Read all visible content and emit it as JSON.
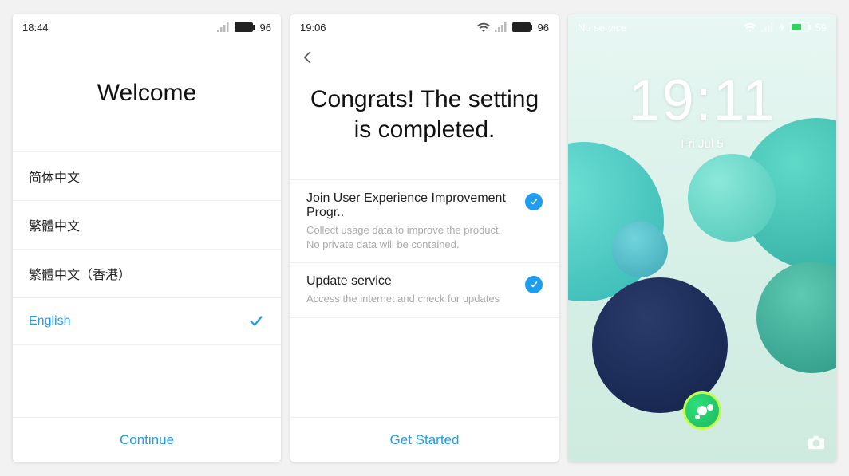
{
  "phone1": {
    "status": {
      "time": "18:44",
      "battery": "96"
    },
    "title": "Welcome",
    "langs": [
      "简体中文",
      "繁體中文",
      "繁體中文（香港）",
      "English"
    ],
    "selected": 3,
    "cta": "Continue"
  },
  "phone2": {
    "status": {
      "time": "19:06",
      "battery": "96"
    },
    "title": "Congrats! The setting is completed.",
    "opts": [
      {
        "title": "Join User Experience Improvement Progr..",
        "sub": "Collect usage data to improve the product. No private data will be contained."
      },
      {
        "title": "Update service",
        "sub": "Access the internet and check for updates"
      }
    ],
    "cta": "Get Started"
  },
  "phone3": {
    "status": {
      "service": "No service",
      "battery": "59"
    },
    "clock": "19:11",
    "date": "Fri  Jul 5"
  }
}
